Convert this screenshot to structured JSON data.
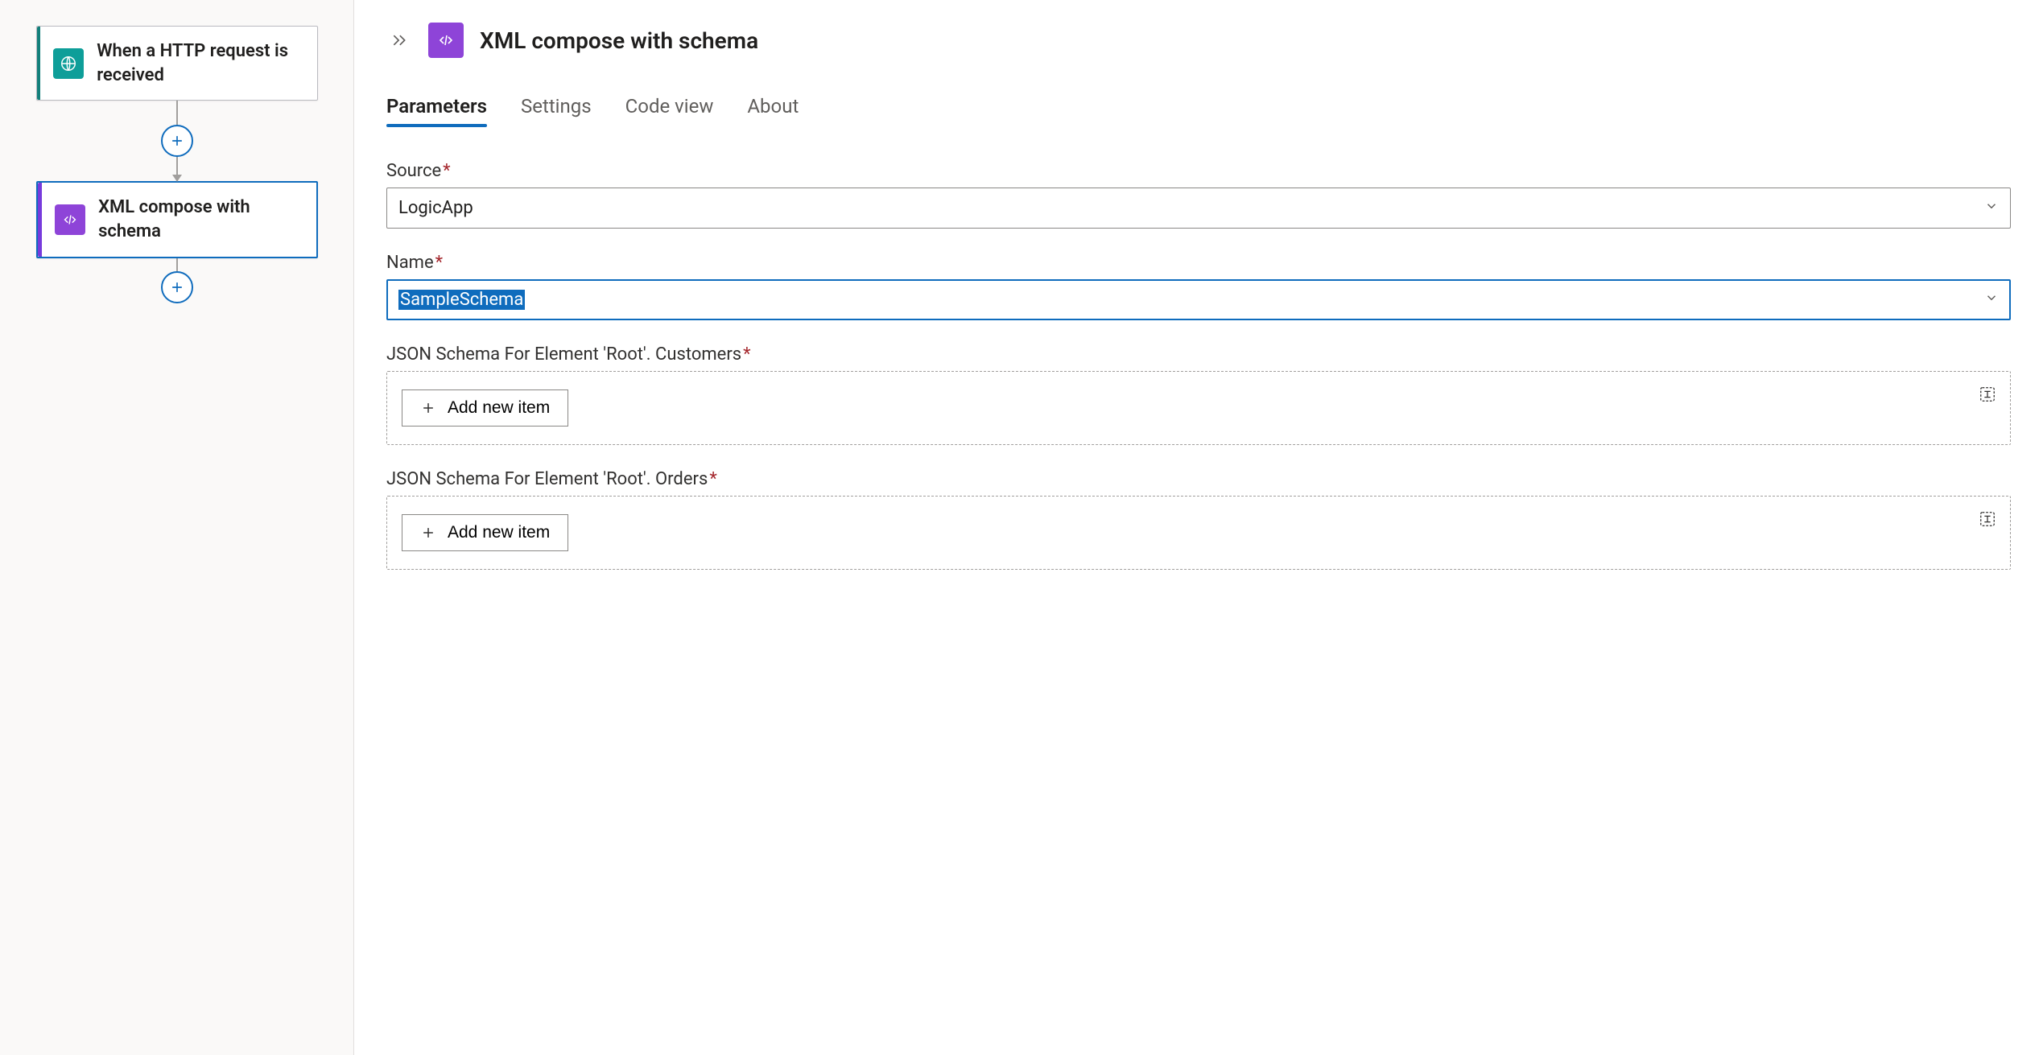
{
  "canvas": {
    "trigger": {
      "title": "When a HTTP request is received",
      "icon": "globe-icon"
    },
    "action": {
      "title": "XML compose with schema",
      "icon": "xml-icon"
    }
  },
  "panel": {
    "title": "XML compose with schema"
  },
  "tabs": [
    {
      "id": "parameters",
      "label": "Parameters",
      "active": true
    },
    {
      "id": "settings",
      "label": "Settings",
      "active": false
    },
    {
      "id": "codeview",
      "label": "Code view",
      "active": false
    },
    {
      "id": "about",
      "label": "About",
      "active": false
    }
  ],
  "fields": {
    "source": {
      "label": "Source",
      "value": "LogicApp"
    },
    "name": {
      "label": "Name",
      "value": "SampleSchema"
    },
    "customers": {
      "label": "JSON Schema For Element 'Root'. Customers",
      "addLabel": "Add new item"
    },
    "orders": {
      "label": "JSON Schema For Element 'Root'. Orders",
      "addLabel": "Add new item"
    }
  }
}
